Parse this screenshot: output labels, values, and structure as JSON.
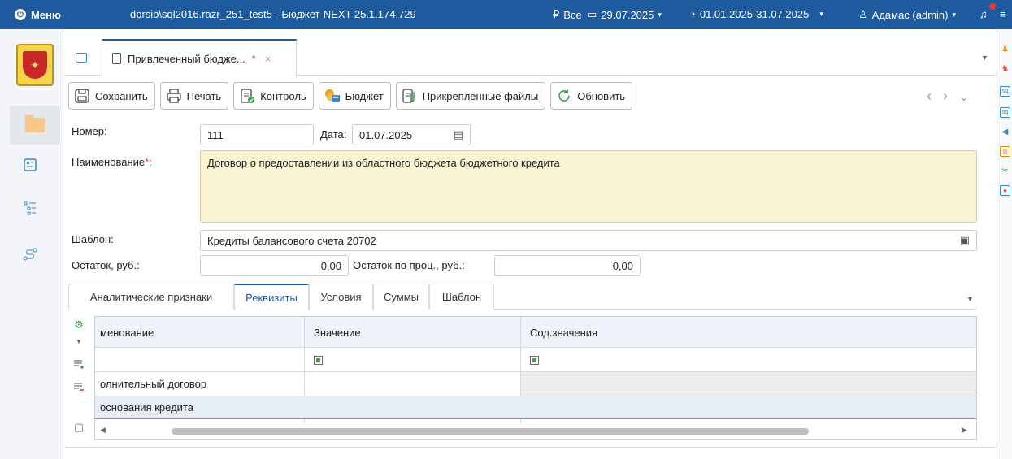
{
  "topbar": {
    "menu_label": "Меню",
    "title": "dprsib\\sql2016.razr_251_test5 - Бюджет-NEXT 25.1.174.729",
    "scope_icon": "ruble-icon",
    "scope_label": "Все",
    "date_label": "29.07.2025",
    "period_label": "01.01.2025-31.07.2025",
    "user_label": "Адамас (admin)"
  },
  "tabs": {
    "doc_tab_label": "Привлеченный бюдже...",
    "modified_mark": "*",
    "close_glyph": "×"
  },
  "toolbar": {
    "save": "Сохранить",
    "print": "Печать",
    "control": "Контроль",
    "budget": "Бюджет",
    "attached_files": "Прикрепленные файлы",
    "refresh": "Обновить"
  },
  "form": {
    "number_label": "Номер:",
    "number_value": "111",
    "date_label": "Дата:",
    "date_value": "01.07.2025",
    "name_label": "Наименование",
    "name_required_mark": "*",
    "name_colon": ":",
    "name_value": "Договор о предоставлении из областного бюджета бюджетного кредита",
    "template_label": "Шаблон:",
    "template_value": "Кредиты балансового счета 20702",
    "balance_label": "Остаток, руб.:",
    "balance_value": "0,00",
    "interest_balance_label": "Остаток по проц., руб.:",
    "interest_balance_value": "0,00"
  },
  "detail_tabs": [
    "Аналитические признаки",
    "Реквизиты",
    "Условия",
    "Суммы",
    "Шаблон"
  ],
  "detail_active_tab": "Реквизиты",
  "grid": {
    "columns": [
      "менование",
      "Значение",
      "Сод.значения"
    ],
    "rows": [
      [
        "олнительный договор",
        "",
        ""
      ],
      [
        "основания кредита",
        "",
        ""
      ]
    ]
  },
  "colors": {
    "topbar": "#1e5a9e",
    "required_field_bg": "#fbf4d2",
    "accent": "#1e5a9e",
    "notification_dot": "#e53935"
  }
}
